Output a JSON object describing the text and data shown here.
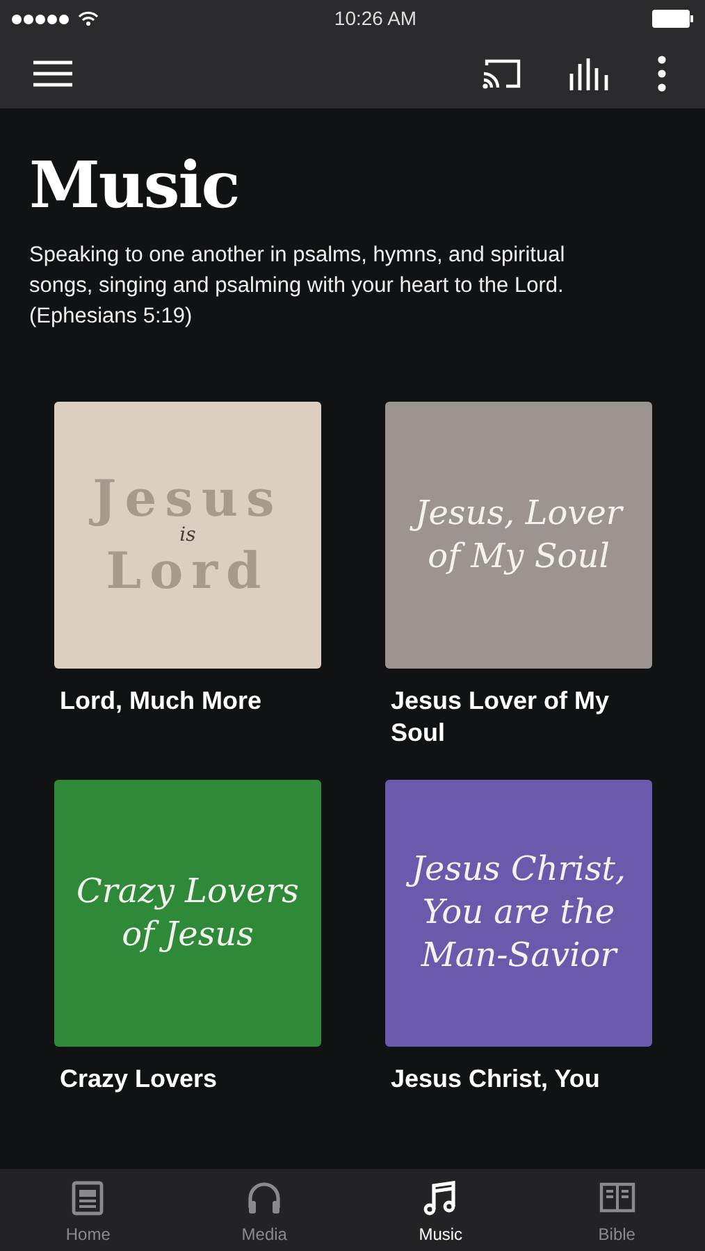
{
  "status_bar": {
    "time": "10:26 AM"
  },
  "header": {
    "title": "Music",
    "description": "Speaking to one another in psalms, hymns, and spiritual songs, singing and psalming with your heart to the Lord. (Ephesians 5:19)"
  },
  "albums": [
    {
      "title": "Lord, Much More",
      "kind": "stacked",
      "color": "#dccfc2",
      "cover_lines": [
        "Jesus",
        "is",
        "Lord"
      ]
    },
    {
      "title": "Jesus Lover of My Soul",
      "kind": "italic",
      "color": "#9c9490",
      "cover_lines": [
        "Jesus, Lover of My Soul"
      ]
    },
    {
      "title": "Crazy Lovers",
      "kind": "italic",
      "color": "#2e8a39",
      "cover_lines": [
        "Crazy Lovers of Jesus"
      ]
    },
    {
      "title": "Jesus Christ, You",
      "kind": "italic",
      "color": "#6a5aac",
      "cover_lines": [
        "Jesus Christ, You are the Man-Savior"
      ]
    }
  ],
  "tabs": [
    {
      "label": "Home",
      "selected": false
    },
    {
      "label": "Media",
      "selected": false
    },
    {
      "label": "Music",
      "selected": true
    },
    {
      "label": "Bible",
      "selected": false
    }
  ]
}
